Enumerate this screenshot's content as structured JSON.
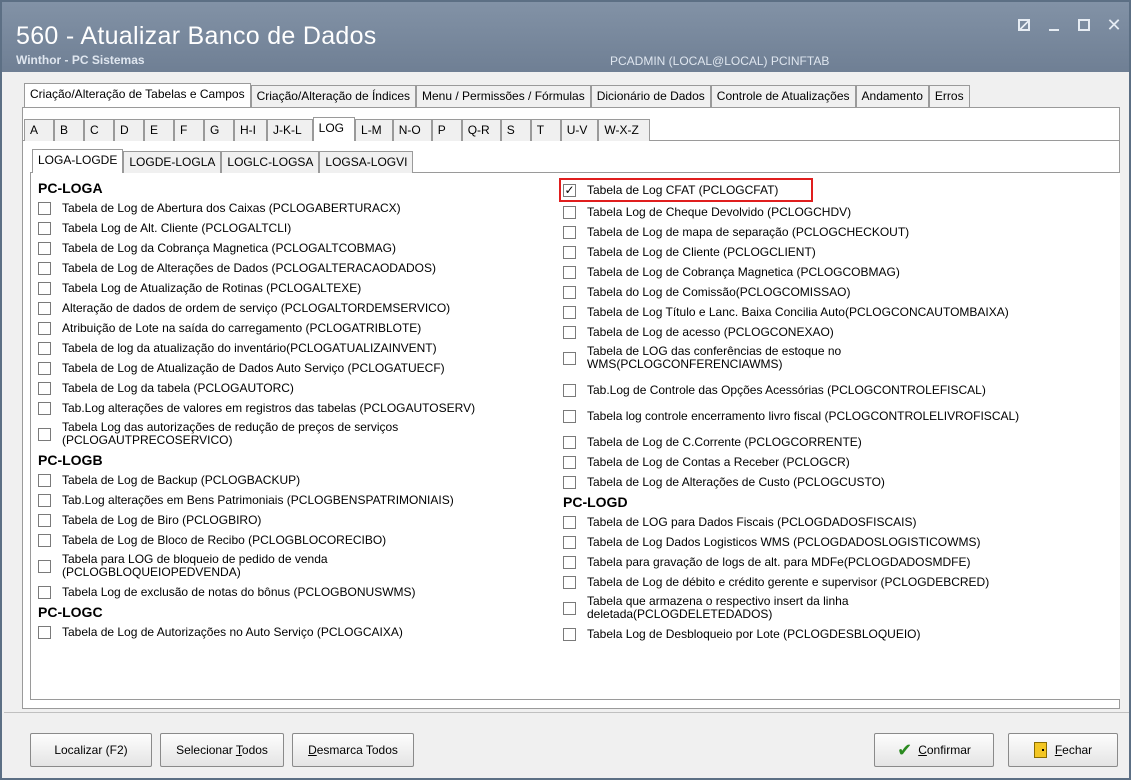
{
  "window": {
    "title": "560 - Atualizar Banco de Dados",
    "subtitle": "Winthor - PC Sistemas",
    "user_info": "PCADMIN (LOCAL@LOCAL)   PCINFTAB"
  },
  "main_tabs": [
    {
      "label": "Criação/Alteração de Tabelas e Campos",
      "active": true
    },
    {
      "label": "Criação/Alteração de Índices"
    },
    {
      "label": "Menu / Permissões / Fórmulas"
    },
    {
      "label": "Dicionário de Dados"
    },
    {
      "label": "Controle de Atualizações"
    },
    {
      "label": "Andamento"
    },
    {
      "label": "Erros"
    }
  ],
  "letter_tabs": [
    {
      "label": "A"
    },
    {
      "label": "B"
    },
    {
      "label": "C"
    },
    {
      "label": "D"
    },
    {
      "label": "E"
    },
    {
      "label": "F"
    },
    {
      "label": "G"
    },
    {
      "label": "H-I"
    },
    {
      "label": "J-K-L"
    },
    {
      "label": "LOG",
      "active": true
    },
    {
      "label": "L-M"
    },
    {
      "label": "N-O"
    },
    {
      "label": "P"
    },
    {
      "label": "Q-R"
    },
    {
      "label": "S"
    },
    {
      "label": "T"
    },
    {
      "label": "U-V"
    },
    {
      "label": "W-X-Z"
    }
  ],
  "sub_tabs": [
    {
      "label": "LOGA-LOGDE",
      "active": true
    },
    {
      "label": "LOGDE-LOGLA"
    },
    {
      "label": "LOGLC-LOGSA"
    },
    {
      "label": "LOGSA-LOGVI"
    }
  ],
  "left_column": [
    {
      "group": "PC-LOGA",
      "items": [
        {
          "label": "Tabela de Log de Abertura dos Caixas (PCLOGABERTURACX)",
          "checked": false
        },
        {
          "label": "Tabela Log de Alt. Cliente (PCLOGALTCLI)",
          "checked": false
        },
        {
          "label": "Tabela de Log da Cobrança Magnetica (PCLOGALTCOBMAG)",
          "checked": false
        },
        {
          "label": "Tabela de Log de Alterações de Dados (PCLOGALTERACAODADOS)",
          "checked": false
        },
        {
          "label": "Tabela Log de Atualização de Rotinas (PCLOGALTEXE)",
          "checked": false
        },
        {
          "label": "Alteração de dados de ordem de serviço (PCLOGALTORDEMSERVICO)",
          "checked": false
        },
        {
          "label": "Atribuição de Lote na saída do carregamento (PCLOGATRIBLOTE)",
          "checked": false
        },
        {
          "label": "Tabela de log da atualização do inventário(PCLOGATUALIZAINVENT)",
          "checked": false
        },
        {
          "label": "Tabela de Log de Atualização de Dados Auto Serviço (PCLOGATUECF)",
          "checked": false
        },
        {
          "label": "Tabela de Log da tabela (PCLOGAUTORC)",
          "checked": false
        },
        {
          "label": "Tab.Log alterações de valores em registros das tabelas (PCLOGAUTOSERV)",
          "checked": false
        },
        {
          "label": "Tabela Log das autorizações de redução de preços de serviços\n(PCLOGAUTPRECOSERVICO)",
          "checked": false,
          "two_line": true
        }
      ]
    },
    {
      "group": "PC-LOGB",
      "items": [
        {
          "label": "Tabela de Log de Backup (PCLOGBACKUP)",
          "checked": false
        },
        {
          "label": "Tab.Log alterações em Bens Patrimoniais (PCLOGBENSPATRIMONIAIS)",
          "checked": false
        },
        {
          "label": "Tabela de Log de Biro (PCLOGBIRO)",
          "checked": false
        },
        {
          "label": "Tabela de Log de Bloco de Recibo (PCLOGBLOCORECIBO)",
          "checked": false
        },
        {
          "label": "Tabela para LOG de bloqueio de pedido de venda\n(PCLOGBLOQUEIOPEDVENDA)",
          "checked": false,
          "two_line": true
        },
        {
          "label": "Tabela Log de exclusão de notas do bônus (PCLOGBONUSWMS)",
          "checked": false
        }
      ]
    },
    {
      "group": "PC-LOGC",
      "items": [
        {
          "label": "Tabela de Log de Autorizações no Auto Serviço (PCLOGCAIXA)",
          "checked": false
        }
      ]
    }
  ],
  "right_column": [
    {
      "group": "",
      "items": [
        {
          "label": "Tabela de Log CFAT (PCLOGCFAT)",
          "checked": true,
          "highlight": true
        },
        {
          "label": "Tabela Log de Cheque Devolvido (PCLOGCHDV)",
          "checked": false
        },
        {
          "label": "Tabela de Log de mapa de separação (PCLOGCHECKOUT)",
          "checked": false
        },
        {
          "label": "Tabela de Log de Cliente (PCLOGCLIENT)",
          "checked": false
        },
        {
          "label": "Tabela de Log de Cobrança Magnetica (PCLOGCOBMAG)",
          "checked": false
        },
        {
          "label": "Tabela do Log de Comissão(PCLOGCOMISSAO)",
          "checked": false
        },
        {
          "label": "Tabela de Log Título e Lanc. Baixa Concilia Auto(PCLOGCONCAUTOMBAIXA)",
          "checked": false
        },
        {
          "label": "Tabela de Log de acesso (PCLOGCONEXAO)",
          "checked": false
        },
        {
          "label": "Tabela de LOG das conferências de estoque no\nWMS(PCLOGCONFERENCIAWMS)",
          "checked": false,
          "two_line": true
        },
        {
          "label": "Tab.Log de Controle das Opções Acessórias (PCLOGCONTROLEFISCAL)",
          "checked": false,
          "spaced": true
        },
        {
          "label": "Tabela log controle encerramento  livro fiscal (PCLOGCONTROLELIVROFISCAL)",
          "checked": false,
          "spaced": true
        },
        {
          "label": "Tabela de Log de C.Corrente (PCLOGCORRENTE)",
          "checked": false
        },
        {
          "label": "Tabela de Log de Contas a Receber (PCLOGCR)",
          "checked": false
        },
        {
          "label": "Tabela de Log de Alterações de Custo (PCLOGCUSTO)",
          "checked": false
        }
      ]
    },
    {
      "group": "PC-LOGD",
      "items": [
        {
          "label": "Tabela de LOG para Dados Fiscais (PCLOGDADOSFISCAIS)",
          "checked": false
        },
        {
          "label": "Tabela de Log Dados Logisticos WMS (PCLOGDADOSLOGISTICOWMS)",
          "checked": false
        },
        {
          "label": "Tabela para gravação de logs de alt. para MDFe(PCLOGDADOSMDFE)",
          "checked": false
        },
        {
          "label": "Tabela de Log de débito e crédito gerente e supervisor (PCLOGDEBCRED)",
          "checked": false
        },
        {
          "label": "Tabela que armazena o respectivo insert da linha\ndeletada(PCLOGDELETEDADOS)",
          "checked": false,
          "two_line": true
        },
        {
          "label": "Tabela Log de Desbloqueio por Lote (PCLOGDESBLOQUEIO)",
          "checked": false
        }
      ]
    }
  ],
  "buttons": {
    "localizar": "Localizar (F2)",
    "selecionar_prefix": "Selecionar ",
    "selecionar_ul": "T",
    "selecionar_suffix": "odos",
    "desmarca_prefix": "",
    "desmarca_ul": "D",
    "desmarca_suffix": "esmarca Todos",
    "confirmar_ul": "C",
    "confirmar_suffix": "onfirmar",
    "fechar_ul": "F",
    "fechar_suffix": "echar"
  },
  "icons": {
    "confirm": "check-green-icon",
    "close": "exit-door-icon"
  },
  "colors": {
    "titlebar": "#7a8a9f",
    "highlight_border": "#e01e1e",
    "confirm_check": "#2a8a1f"
  }
}
